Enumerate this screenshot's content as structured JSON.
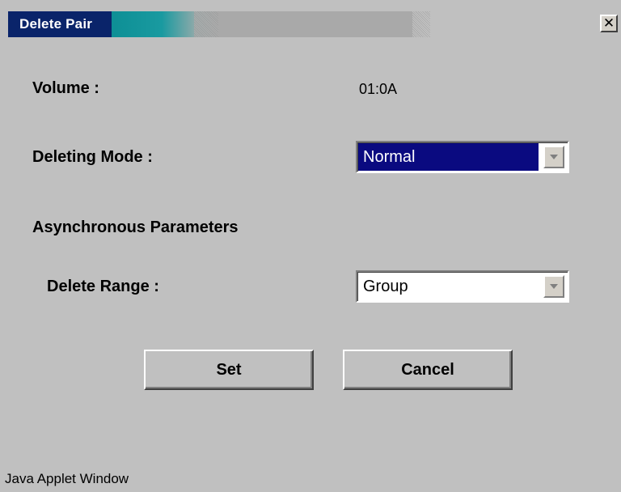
{
  "window": {
    "title": "Delete Pair",
    "close_glyph": "✕",
    "status_text": "Java Applet Window"
  },
  "fields": {
    "volume_label": "Volume :",
    "volume_value": "01:0A",
    "deleting_mode_label": "Deleting Mode :",
    "deleting_mode_value": "Normal",
    "async_section_label": "Asynchronous Parameters",
    "delete_range_label": "Delete Range :",
    "delete_range_value": "Group"
  },
  "buttons": {
    "set_label": "Set",
    "cancel_label": "Cancel"
  },
  "icons": {
    "close": "close-icon",
    "dropdown": "chevron-down-icon"
  },
  "colors": {
    "titlebar_start": "#056f7c",
    "selected_field": "#0a0a80",
    "dialog_background": "#c0c0c0"
  }
}
